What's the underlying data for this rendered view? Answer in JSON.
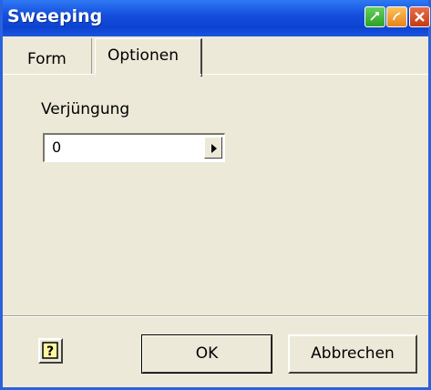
{
  "window": {
    "title": "Sweeping"
  },
  "tabs": [
    {
      "label": "Form",
      "active": false
    },
    {
      "label": "Optionen",
      "active": true
    }
  ],
  "options": {
    "taper_label": "Verjüngung",
    "taper_value": "0"
  },
  "footer": {
    "ok_label": "OK",
    "cancel_label": "Abbrechen"
  },
  "colors": {
    "titlebar": "#0c42d0",
    "dialog_bg": "#ece9d8"
  },
  "icons": {
    "help": "help-icon",
    "spin": "arrow-right-icon",
    "green": "green-titlebar-icon",
    "orange": "orange-titlebar-icon",
    "close": "close-icon"
  }
}
